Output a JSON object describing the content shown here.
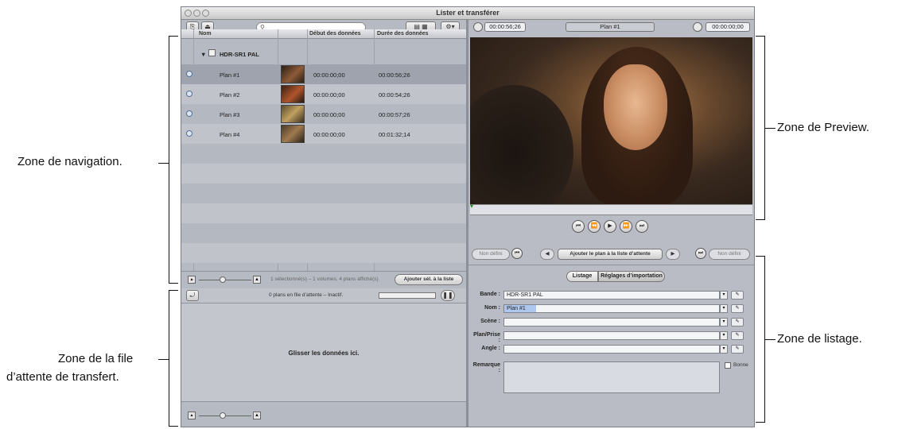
{
  "window": {
    "title": "Lister et transférer"
  },
  "callouts": {
    "navigation": "Zone de navigation.",
    "queue_line1": "Zone de la file",
    "queue_line2": "d’attente de transfert.",
    "preview": "Zone de Preview.",
    "listing": "Zone de listage."
  },
  "left_panel": {
    "columns": [
      "Nom",
      "Début des données",
      "Durée des données"
    ],
    "volume": "HDR-SR1 PAL",
    "clips": [
      {
        "name": "Plan #1",
        "start": "00:00:00;00",
        "duration": "00:00:56;26"
      },
      {
        "name": "Plan #2",
        "start": "00:00:00;00",
        "duration": "00:00:54;26"
      },
      {
        "name": "Plan #3",
        "start": "00:00:00;00",
        "duration": "00:00:57;26"
      },
      {
        "name": "Plan #4",
        "start": "00:00:00;00",
        "duration": "00:01:32;14"
      }
    ],
    "status": "1 sélectionné(s) – 1 volumes, 4 plans affiché(s)",
    "add_selection_button": "Ajouter sél. à la liste",
    "queue_status": "0 plans en file d’attente – Inactif.",
    "drop_hint": "Glisser les données ici."
  },
  "right_panel": {
    "duration_tc": "00:00:56;26",
    "clip_name": "Plan #1",
    "current_tc": "00:00:00;00",
    "add_to_queue_button": "Ajouter le plan à la liste d’attente",
    "no_prev": "Non défini",
    "no_next": "Non défini",
    "tabs": [
      "Listage",
      "Réglages d’importation"
    ],
    "fields": [
      {
        "label": "Bande :",
        "value": "HDR-SR1 PAL"
      },
      {
        "label": "Nom :",
        "value": "Plan #1"
      },
      {
        "label": "Scène :",
        "value": ""
      },
      {
        "label": "Plan/Prise :",
        "value": ""
      },
      {
        "label": "Angle :",
        "value": ""
      }
    ],
    "remarks_label": "Remarque :",
    "good_label": "Bonne"
  }
}
